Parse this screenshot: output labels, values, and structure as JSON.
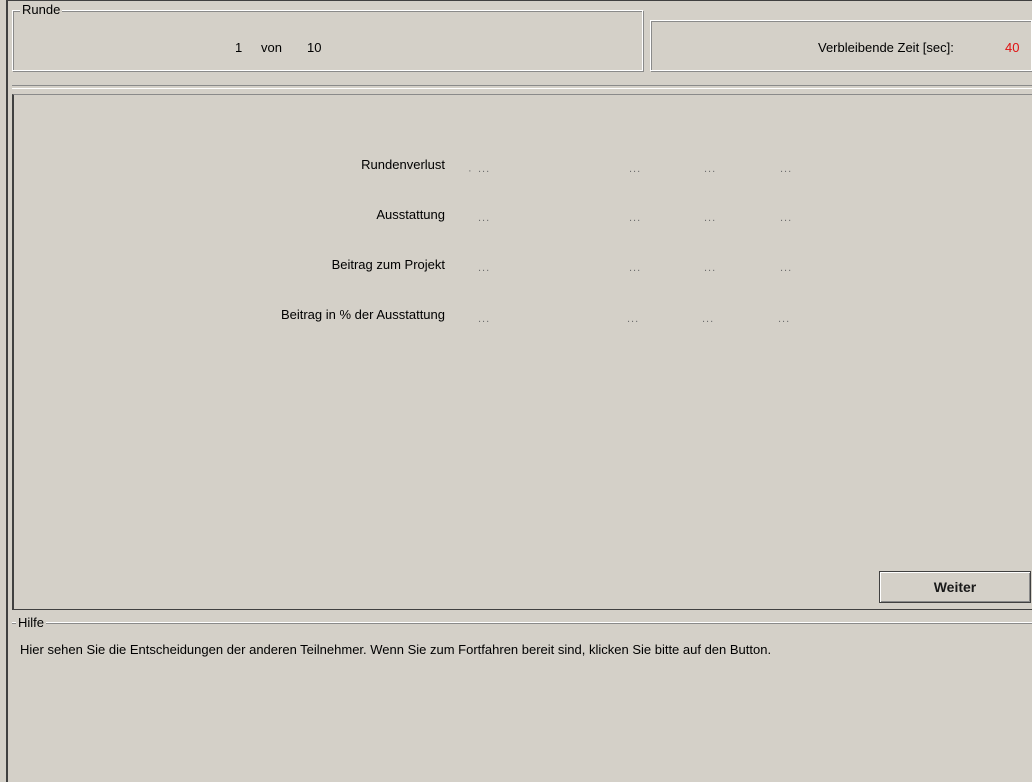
{
  "round": {
    "legend": "Runde",
    "current": "1",
    "of_label": "von",
    "total": "10"
  },
  "timer": {
    "label": "Verbleibende Zeit [sec]:",
    "value": "40",
    "value_color": "#e01010"
  },
  "results": {
    "rows": [
      {
        "label": "Rundenverlust",
        "values": [
          "...",
          "...",
          "...",
          "..."
        ]
      },
      {
        "label": "Ausstattung",
        "values": [
          "...",
          "...",
          "...",
          "..."
        ]
      },
      {
        "label": "Beitrag zum Projekt",
        "values": [
          "...",
          "...",
          "...",
          "..."
        ]
      },
      {
        "label": "Beitrag in % der Ausstattung",
        "values": [
          "...",
          "...",
          "...",
          "..."
        ]
      }
    ]
  },
  "actions": {
    "next_label": "Weiter"
  },
  "help": {
    "legend": "Hilfe",
    "text": "Hier sehen Sie die Entscheidungen der anderen Teilnehmer. Wenn Sie zum Fortfahren bereit sind, klicken Sie bitte auf den Button."
  }
}
